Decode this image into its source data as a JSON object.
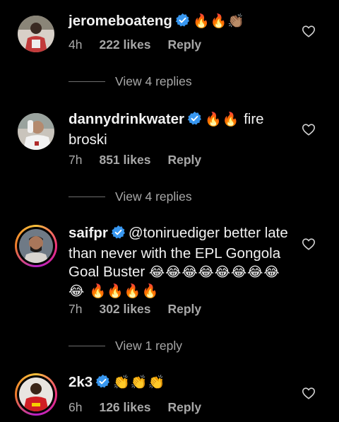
{
  "comments": [
    {
      "username": "jeromeboateng",
      "text": "",
      "emoji": "🔥🔥👏🏽",
      "time": "4h",
      "likes": "222 likes",
      "reply": "Reply",
      "replies": "View 4 replies"
    },
    {
      "username": "dannydrinkwater",
      "text": " fire broski",
      "emoji": "🔥🔥",
      "time": "7h",
      "likes": "851 likes",
      "reply": "Reply",
      "replies": "View 4 replies"
    },
    {
      "username": "saifpr",
      "text": "@toniruediger better late than never with the EPL Gongola Goal Buster ",
      "emoji": "😂😂😂😂😂😂😂😂😂 🔥🔥🔥🔥",
      "time": "7h",
      "likes": "302 likes",
      "reply": "Reply",
      "replies": "View 1 reply"
    },
    {
      "username": "2k3",
      "text": "",
      "emoji": "👏👏👏",
      "time": "6h",
      "likes": "126 likes",
      "reply": "Reply"
    }
  ],
  "colors": {
    "background": "#000000",
    "text": "#f2f2f2",
    "meta": "#a8a8a8",
    "verified": "#3897f0"
  },
  "icons": {
    "verified": "verified-badge-icon",
    "like": "heart-outline-icon"
  }
}
